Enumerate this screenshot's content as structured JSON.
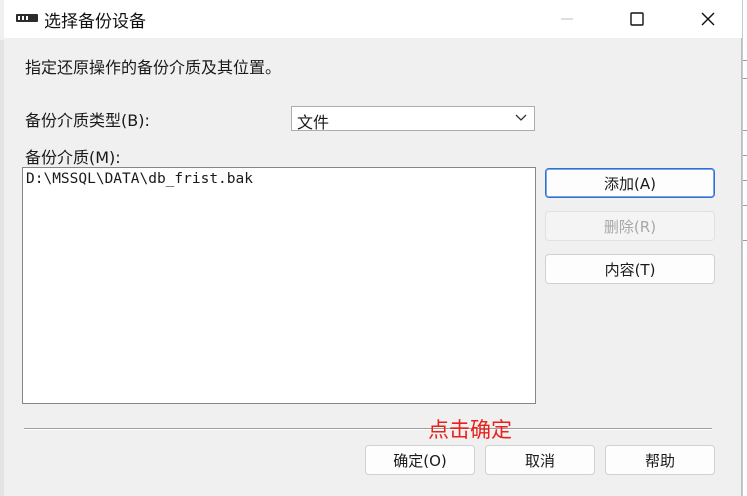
{
  "window": {
    "title": "选择备份设备",
    "controls": {
      "minimize": "minimize",
      "maximize": "maximize",
      "close": "close"
    }
  },
  "instruction": "指定还原操作的备份介质及其位置。",
  "backup_type": {
    "label": "备份介质类型(B):",
    "selected": "文件"
  },
  "backup_media": {
    "label": "备份介质(M):",
    "items": [
      "D:\\MSSQL\\DATA\\db_frist.bak"
    ]
  },
  "side_buttons": {
    "add": "添加(A)",
    "remove": "删除(R)",
    "contents": "内容(T)"
  },
  "annotation": {
    "text": "点击确定",
    "color": "#e8211c"
  },
  "footer_buttons": {
    "ok": "确定(O)",
    "cancel": "取消",
    "help": "帮助"
  },
  "colors": {
    "accent": "#2f6fd0",
    "dialog_bg": "#f0f0f0"
  }
}
